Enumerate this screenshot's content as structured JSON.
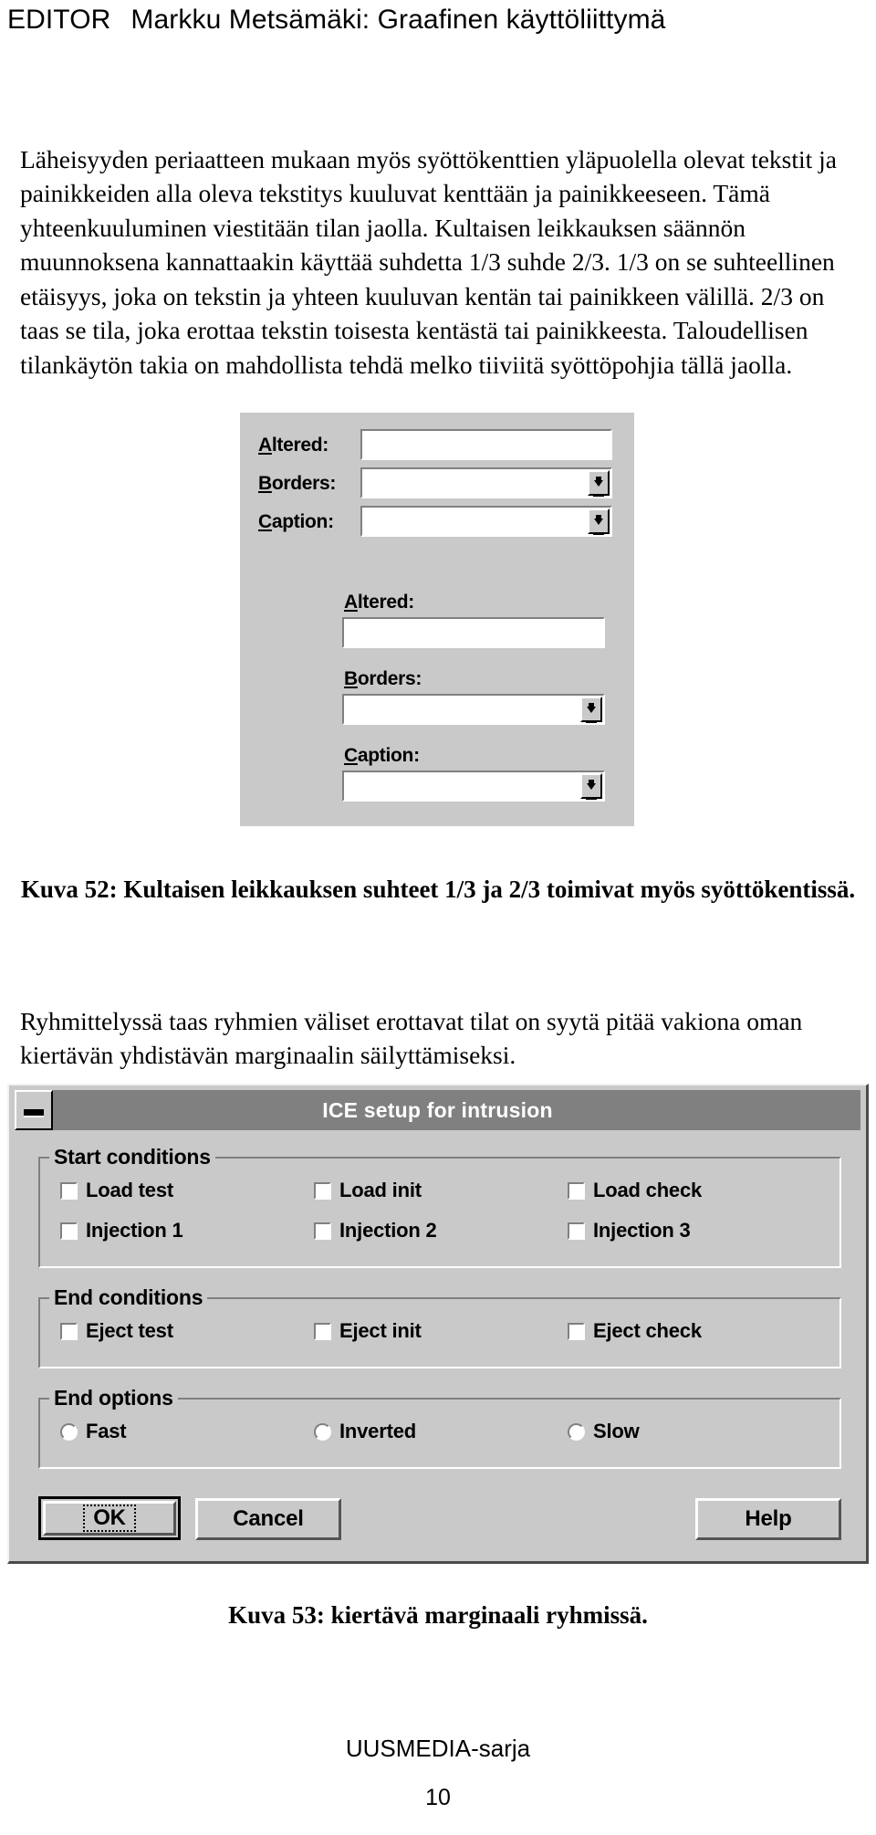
{
  "header": {
    "left_label": "EDITOR",
    "title": "Markku Metsämäki: Graafinen käyttöliittymä"
  },
  "paragraphs": {
    "p1": "Läheisyyden periaatteen mukaan myös syöttökenttien yläpuolella olevat tekstit ja painikkeiden alla oleva tekstitys kuuluvat kenttään ja painikkeeseen. Tämä yhteenkuuluminen viestitään tilan jaolla. Kultaisen leikkauksen säännön muunnoksena kannattaakin käyttää suhdetta 1/3 suhde 2/3. 1/3 on se suhteellinen etäisyys, joka on tekstin ja yhteen kuuluvan kentän tai painikkeen välillä. 2/3 on taas se tila, joka erottaa tekstin toisesta kentästä tai painikkeesta. Taloudellisen tilankäytön takia on mahdollista tehdä melko tiiviitä syöttöpohjia tällä jaolla.",
    "p2": "Ryhmittelyssä taas ryhmien väliset erottavat tilat on syytä pitää vakiona oman kiertävän yhdistävän marginaalin säilyttämiseksi."
  },
  "figure_52": {
    "caption": "Kuva 52: Kultaisen leikkauksen suhteet 1/3 ja 2/3 toimivat myös syöttökentissä.",
    "top_block": [
      {
        "label_prefix": "A",
        "label_rest": "ltered:",
        "type": "text",
        "value": ""
      },
      {
        "label_prefix": "B",
        "label_rest": "orders:",
        "type": "combo",
        "value": ""
      },
      {
        "label_prefix": "C",
        "label_rest": "aption:",
        "type": "combo",
        "value": ""
      }
    ],
    "bottom_block": [
      {
        "label_prefix": "A",
        "label_rest": "ltered:",
        "type": "text",
        "value": ""
      },
      {
        "label_prefix": "B",
        "label_rest": "orders:",
        "type": "combo",
        "value": ""
      },
      {
        "label_prefix": "C",
        "label_rest": "aption:",
        "type": "combo",
        "value": ""
      }
    ]
  },
  "figure_53": {
    "caption": "Kuva 53: kiertävä marginaali ryhmissä.",
    "title": "ICE setup for intrusion",
    "minimize_icon": "minimize-icon",
    "groups": [
      {
        "title": "Start conditions",
        "control_type": "checkbox",
        "items": [
          {
            "label": "Load test",
            "checked": false
          },
          {
            "label": "Load init",
            "checked": false
          },
          {
            "label": "Load check",
            "checked": false
          },
          {
            "label": "Injection 1",
            "checked": false
          },
          {
            "label": "Injection 2",
            "checked": false
          },
          {
            "label": "Injection 3",
            "checked": false
          }
        ]
      },
      {
        "title": "End conditions",
        "control_type": "checkbox",
        "items": [
          {
            "label": "Eject test",
            "checked": false
          },
          {
            "label": "Eject init",
            "checked": false
          },
          {
            "label": "Eject check",
            "checked": false
          }
        ]
      },
      {
        "title": "End options",
        "control_type": "radio",
        "items": [
          {
            "label": "Fast",
            "checked": false
          },
          {
            "label": "Inverted",
            "checked": false
          },
          {
            "label": "Slow",
            "checked": false
          }
        ]
      }
    ],
    "buttons": {
      "ok": "OK",
      "cancel": "Cancel",
      "help": "Help"
    }
  },
  "footer": {
    "series": "UUSMEDIA-sarja",
    "page_number": "10"
  },
  "colors": {
    "dialog_face": "#c9c9c9",
    "titlebar": "#808080",
    "titlebar_text": "#ffffff",
    "field_white": "#ffffff",
    "shadow": "#808080",
    "text": "#000000"
  }
}
